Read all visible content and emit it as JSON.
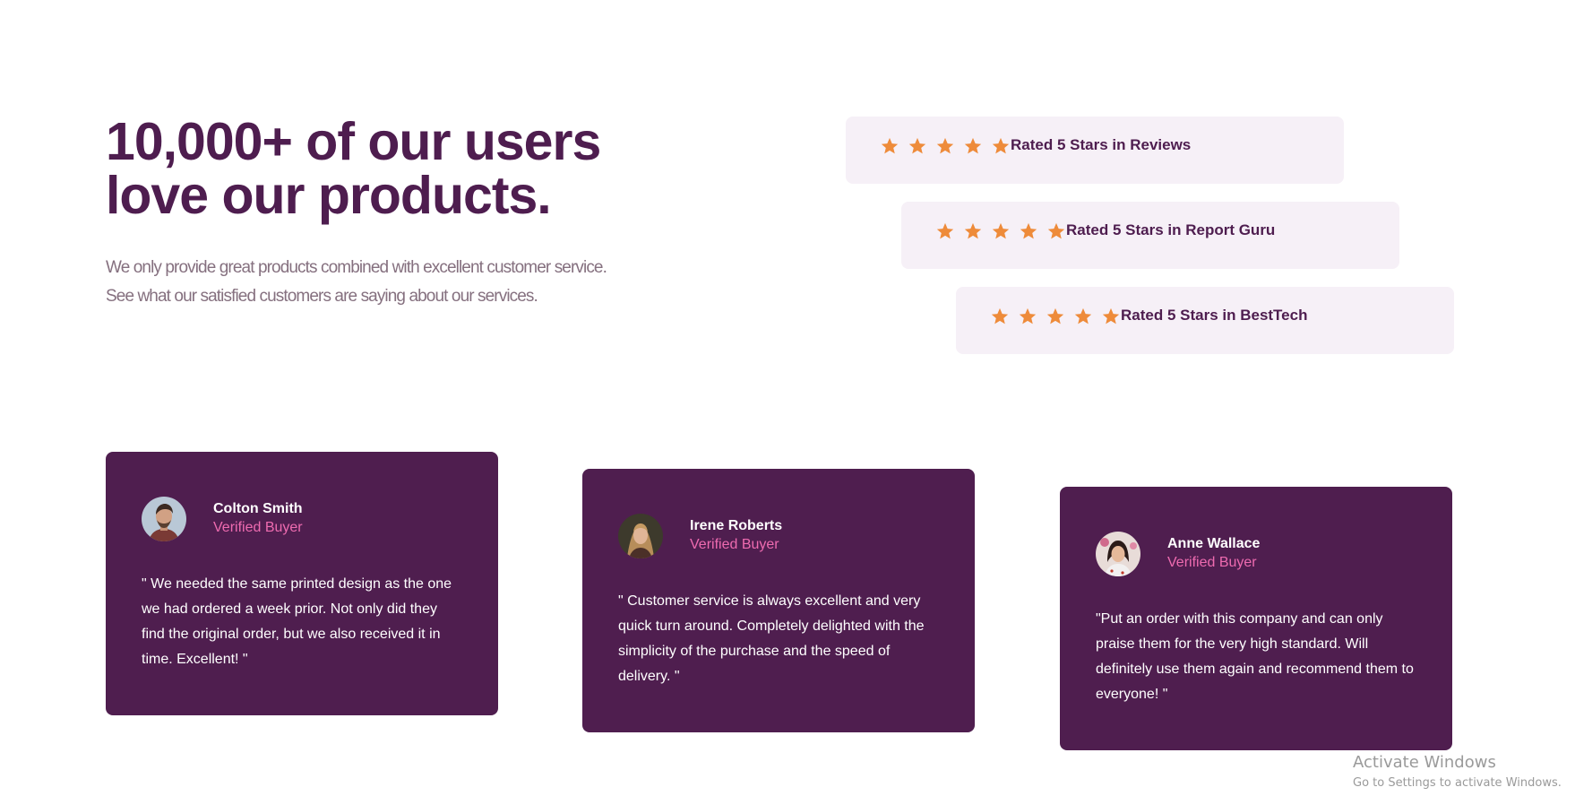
{
  "hero": {
    "headline_line1": "10,000+ of our users",
    "headline_line2": "love our products.",
    "intro_line1": "We only provide great products combined with excellent customer service.",
    "intro_line2": "See what our satisfied customers are saying about our services."
  },
  "ratings": [
    {
      "stars": 5,
      "label": "Rated 5 Stars in Reviews"
    },
    {
      "stars": 5,
      "label": "Rated 5 Stars in Report Guru"
    },
    {
      "stars": 5,
      "label": "Rated 5 Stars in BestTech"
    }
  ],
  "testimonials": [
    {
      "name": "Colton Smith",
      "role": "Verified Buyer",
      "quote": "\" We needed the same printed design as the one we had ordered a week prior. Not only did they find the original order, but we also received it in time. Excellent! \""
    },
    {
      "name": "Irene Roberts",
      "role": "Verified Buyer",
      "quote": "\" Customer service is always excellent and very quick turn around. Completely delighted with the simplicity of the purchase and the speed of delivery. \""
    },
    {
      "name": "Anne Wallace",
      "role": "Verified Buyer",
      "quote": "\"Put an order with this company and can only praise them for the very high standard. Will definitely use them again and recommend them to everyone! \""
    }
  ],
  "watermark": {
    "title": "Activate Windows",
    "subtitle": "Go to Settings to activate Windows."
  },
  "colors": {
    "primary": "#4e1d4f",
    "accent_pink": "#ee6bb0",
    "star": "#ee8b3a",
    "rating_bg": "#f6f0f7",
    "text_muted": "#85707f"
  },
  "icons": {
    "star": "star-icon",
    "avatar": "avatar"
  }
}
